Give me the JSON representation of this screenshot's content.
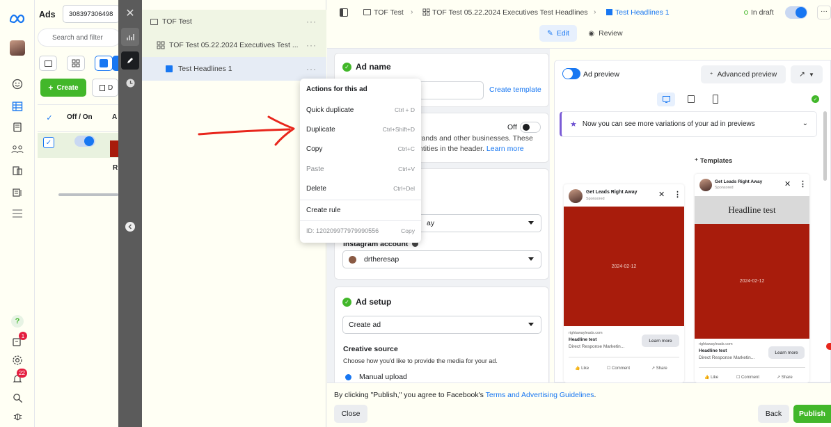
{
  "rail": {
    "badge_notifications": "1",
    "badge_alerts": "22"
  },
  "ads_panel": {
    "title": "Ads",
    "account_id": "308397306498",
    "search_placeholder": "Search and filter",
    "create_label": "Create",
    "dup_label": "D",
    "col_off_on": "Off / On",
    "col_a": "A",
    "row_r": "R"
  },
  "tree": {
    "campaign": "TOF Test",
    "adset": "TOF Test 05.22.2024 Executives Test ...",
    "ad": "Test Headlines 1",
    "more": "···"
  },
  "menu": {
    "title": "Actions for this ad",
    "items": [
      {
        "label": "Quick duplicate",
        "shortcut": "Ctrl + D"
      },
      {
        "label": "Duplicate",
        "shortcut": "Ctrl+Shift+D"
      },
      {
        "label": "Copy",
        "shortcut": "Ctrl+C"
      },
      {
        "label": "Paste",
        "shortcut": "Ctrl+V"
      },
      {
        "label": "Delete",
        "shortcut": "Ctrl+Del"
      },
      {
        "label": "Create rule",
        "shortcut": ""
      }
    ],
    "id_text": "ID: 120209977979990556",
    "copy_label": "Copy"
  },
  "topbar": {
    "crumb1": "TOF Test",
    "crumb2": "TOF Test 05.22.2024 Executives Test Headlines",
    "crumb3": "Test Headlines 1",
    "status": "In draft",
    "edit": "Edit",
    "review": "Review"
  },
  "adname": {
    "title": "Ad name",
    "create_template": "Create template"
  },
  "partnership": {
    "off": "Off",
    "line1": "rands and other businesses. These",
    "line2": "ntities in the header.",
    "learn_more": "Learn more"
  },
  "identity": {
    "page_value": "ay",
    "ig_label": "Instagram account",
    "ig_value": "drtheresap"
  },
  "adsetup": {
    "title": "Ad setup",
    "create_ad": "Create ad",
    "creative_source": "Creative source",
    "creative_desc": "Choose how you'd like to provide the media for your ad.",
    "manual_upload": "Manual upload"
  },
  "footer": {
    "terms_prefix": "By clicking \"Publish,\" you agree to Facebook's ",
    "terms_link": "Terms and Advertising Guidelines",
    "terms_suffix": ".",
    "close": "Close",
    "back": "Back",
    "publish": "Publish"
  },
  "preview": {
    "label": "Ad preview",
    "advanced": "Advanced preview",
    "banner": "Now you can see more variations of your ad in previews",
    "templates": "Templates",
    "card1": {
      "page": "Get Leads Right Away",
      "sponsored": "Sponsored",
      "image_date": "2024-02-12",
      "domain": "rightawayleads.com",
      "headline": "Headline test",
      "desc": "Direct Response Marketin...",
      "cta": "Learn more",
      "like": "Like",
      "comment": "Comment",
      "share": "Share"
    },
    "card2": {
      "page": "Get Leads Right Away",
      "sponsored": "Sponsored",
      "headline_band": "Headline test",
      "image_date": "2024-02-12",
      "domain": "rightawayleads.com",
      "headline": "Headline test",
      "desc": "Direct Response Marketin...",
      "cta": "Learn more",
      "like": "Like",
      "comment": "Comment",
      "share": "Share"
    }
  },
  "colors": {
    "accent": "#1877f2",
    "green": "#42b72a",
    "ad_red": "#a81c0c",
    "annotation_red": "#e8261c"
  }
}
